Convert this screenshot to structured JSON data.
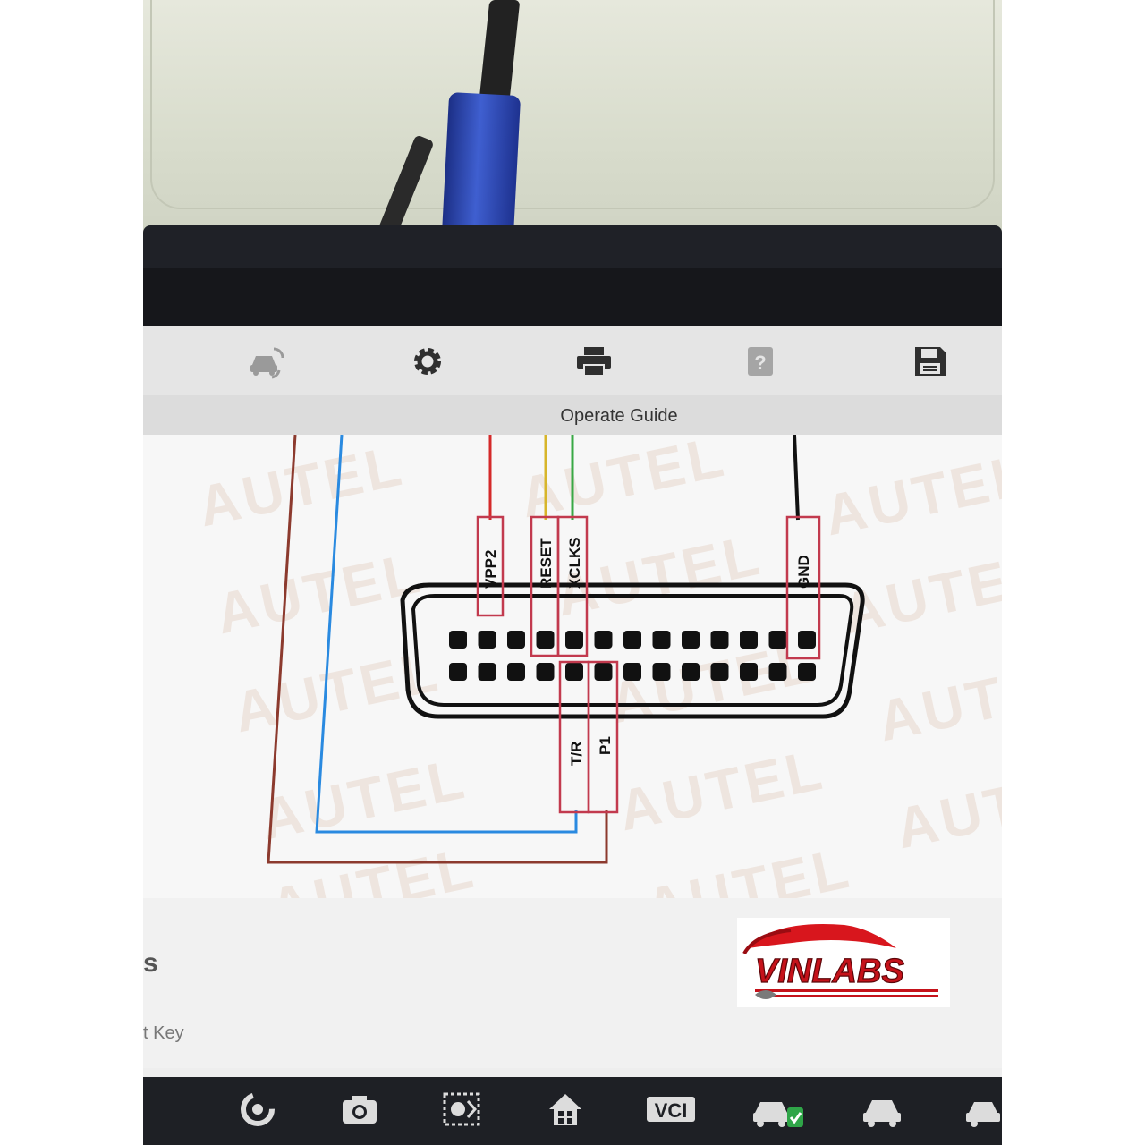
{
  "toolbar": {
    "items": [
      {
        "icon": "vehicle-swap-icon"
      },
      {
        "icon": "gear-icon"
      },
      {
        "icon": "printer-icon"
      },
      {
        "icon": "help-icon"
      },
      {
        "icon": "save-icon"
      }
    ]
  },
  "dialog": {
    "title": "Operate Guide"
  },
  "diagram": {
    "watermark": "AUTEL",
    "top_pins": [
      "VPP2",
      "RESET",
      "XCLKS",
      "GND"
    ],
    "bottom_pins": [
      "T/R",
      "P1"
    ],
    "wire_colors": {
      "vpp2": "#d42a2a",
      "reset": "#d7b52a",
      "xclks": "#39a845",
      "gnd": "#111111",
      "blue_loop": "#2a8ae0",
      "brown_loop": "#8c3a2e"
    }
  },
  "background_text": {
    "heading_fragment": "s",
    "item_fragment": "t Key"
  },
  "logo": {
    "text": "VINLABS"
  },
  "navbar": {
    "items": [
      {
        "icon": "chrome-icon"
      },
      {
        "icon": "camera-icon"
      },
      {
        "icon": "brightness-icon"
      },
      {
        "icon": "home-icon"
      },
      {
        "icon": "vci-icon",
        "label": "VCI"
      },
      {
        "icon": "car-check-icon"
      },
      {
        "icon": "car-icon"
      },
      {
        "icon": "car-service-icon"
      }
    ]
  }
}
